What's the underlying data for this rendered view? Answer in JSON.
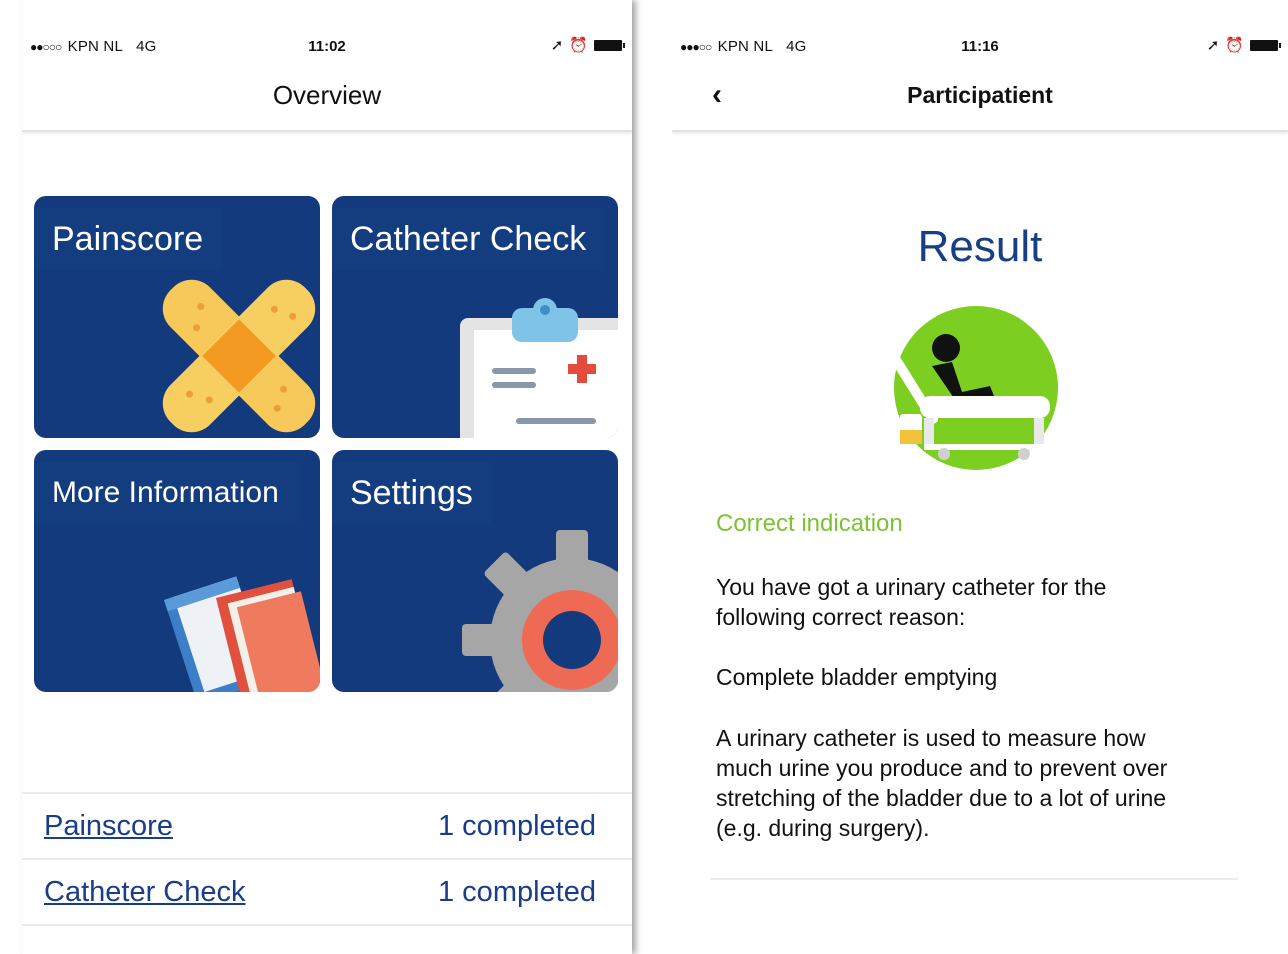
{
  "left": {
    "status": {
      "carrier": "KPN NL",
      "network": "4G",
      "time": "11:02"
    },
    "title": "Overview",
    "tiles": [
      {
        "label": "Painscore",
        "icon": "bandage-icon"
      },
      {
        "label": "Catheter Check",
        "icon": "clipboard-icon"
      },
      {
        "label": "More Information",
        "icon": "books-icon"
      },
      {
        "label": "Settings",
        "icon": "gear-icon"
      }
    ],
    "summary": [
      {
        "name": "Painscore",
        "count": "1 completed"
      },
      {
        "name": "Catheter Check",
        "count": "1 completed"
      }
    ]
  },
  "right": {
    "status": {
      "carrier": "KPN NL",
      "network": "4G",
      "time": "11:16"
    },
    "title": "Participatient",
    "back_icon": "chevron-left-icon",
    "result_title": "Result",
    "indication": "Correct indication",
    "paragraph1_line1": "You have got a urinary catheter for the",
    "paragraph1_line2": "following correct reason:",
    "reason": "Complete bladder emptying",
    "paragraph2_line1": "A urinary catheter is used to measure how",
    "paragraph2_line2": "much urine you produce and to prevent over",
    "paragraph2_line3": "stretching of the bladder due to a lot of urine",
    "paragraph2_line4": "(e.g. during surgery).",
    "colors": {
      "navy": "#133a7c",
      "green": "#7dc232",
      "link": "#1a3d8a"
    }
  }
}
